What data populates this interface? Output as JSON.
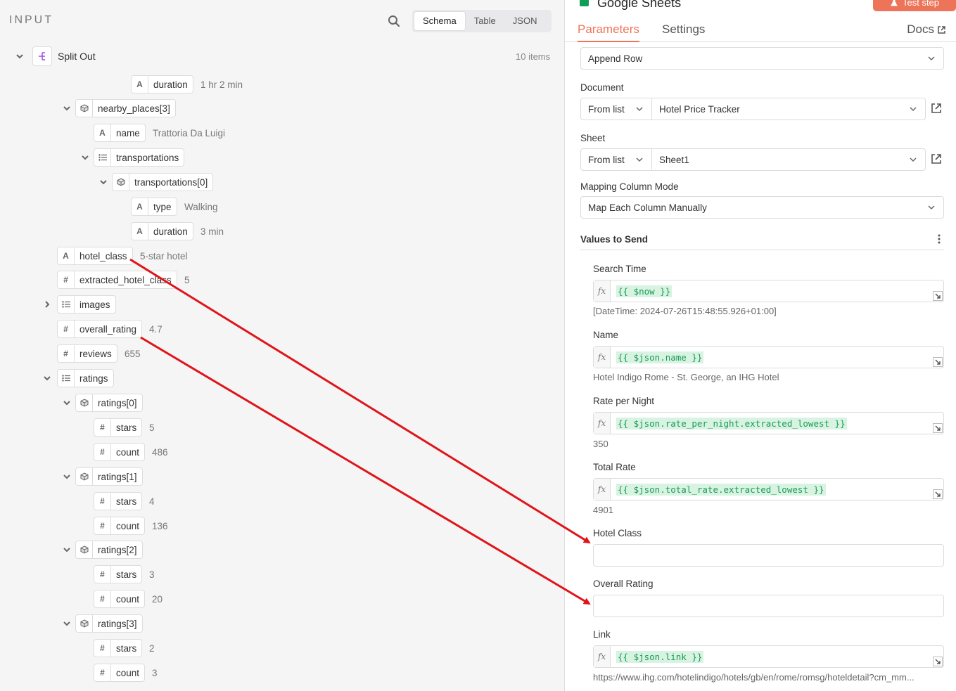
{
  "input_panel": {
    "title": "INPUT",
    "view_options": [
      "Schema",
      "Table",
      "JSON"
    ],
    "active_view": "Schema",
    "node": {
      "label": "Split Out",
      "items_count": "10 items"
    },
    "tree": [
      {
        "type": "A",
        "label": "duration",
        "value": "1 hr 2 min"
      },
      {
        "type": "obj",
        "label": "nearby_places[3]",
        "value": ""
      },
      {
        "type": "A",
        "label": "name",
        "value": "Trattoria Da Luigi"
      },
      {
        "type": "list",
        "label": "transportations",
        "value": ""
      },
      {
        "type": "obj",
        "label": "transportations[0]",
        "value": ""
      },
      {
        "type": "A",
        "label": "type",
        "value": "Walking"
      },
      {
        "type": "A",
        "label": "duration",
        "value": "3 min"
      },
      {
        "type": "A",
        "label": "hotel_class",
        "value": "5-star hotel"
      },
      {
        "type": "#",
        "label": "extracted_hotel_class",
        "value": "5"
      },
      {
        "type": "list",
        "label": "images",
        "value": ""
      },
      {
        "type": "#",
        "label": "overall_rating",
        "value": "4.7"
      },
      {
        "type": "#",
        "label": "reviews",
        "value": "655"
      },
      {
        "type": "list",
        "label": "ratings",
        "value": ""
      },
      {
        "type": "obj",
        "label": "ratings[0]",
        "value": ""
      },
      {
        "type": "#",
        "label": "stars",
        "value": "5"
      },
      {
        "type": "#",
        "label": "count",
        "value": "486"
      },
      {
        "type": "obj",
        "label": "ratings[1]",
        "value": ""
      },
      {
        "type": "#",
        "label": "stars",
        "value": "4"
      },
      {
        "type": "#",
        "label": "count",
        "value": "136"
      },
      {
        "type": "obj",
        "label": "ratings[2]",
        "value": ""
      },
      {
        "type": "#",
        "label": "stars",
        "value": "3"
      },
      {
        "type": "#",
        "label": "count",
        "value": "20"
      },
      {
        "type": "obj",
        "label": "ratings[3]",
        "value": ""
      },
      {
        "type": "#",
        "label": "stars",
        "value": "2"
      },
      {
        "type": "#",
        "label": "count",
        "value": "3"
      }
    ]
  },
  "params_panel": {
    "node_title": "Google Sheets",
    "test_step_label": "Test step",
    "tabs": [
      "Parameters",
      "Settings"
    ],
    "active_tab": "Parameters",
    "docs_label": "Docs",
    "operation_value": "Append Row",
    "document": {
      "label": "Document",
      "mode": "From list",
      "value": "Hotel Price Tracker"
    },
    "sheet": {
      "label": "Sheet",
      "mode": "From list",
      "value": "Sheet1"
    },
    "mapping": {
      "label": "Mapping Column Mode",
      "value": "Map Each Column Manually"
    },
    "values_to_send_label": "Values to Send",
    "fields": [
      {
        "label": "Search Time",
        "expression": "{{ $now }}",
        "result": "[DateTime: 2024-07-26T15:48:55.926+01:00]"
      },
      {
        "label": "Name",
        "expression": "{{ $json.name }}",
        "result": "Hotel Indigo Rome - St. George, an IHG Hotel"
      },
      {
        "label": "Rate per Night",
        "expression": "{{ $json.rate_per_night.extracted_lowest }}",
        "result": "350"
      },
      {
        "label": "Total Rate",
        "expression": "{{ $json.total_rate.extracted_lowest }}",
        "result": "4901"
      },
      {
        "label": "Hotel Class",
        "expression": "",
        "result": ""
      },
      {
        "label": "Overall Rating",
        "expression": "",
        "result": ""
      },
      {
        "label": "Link",
        "expression": "{{ $json.link }}",
        "result": "https://www.ihg.com/hotelindigo/hotels/gb/en/rome/romsg/hoteldetail?cm_mm..."
      }
    ],
    "fx_label": "fx"
  },
  "colors": {
    "accent": "#ee7459",
    "expression_green": "#1a9c55",
    "arrow_red": "#e0141b"
  },
  "icons": {
    "search": "search-icon",
    "external": "external-link-icon",
    "chevron": "chevron-down-icon"
  }
}
